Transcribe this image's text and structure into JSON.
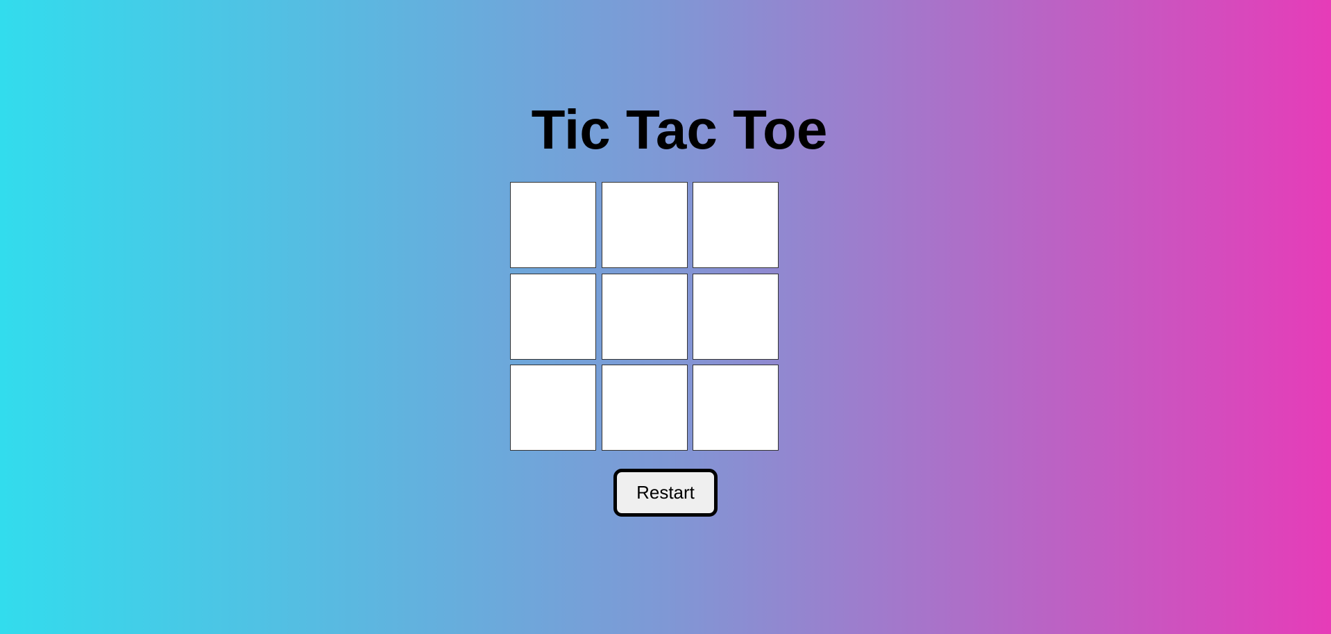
{
  "game": {
    "title": "Tic Tac Toe",
    "board": {
      "cells": [
        "",
        "",
        "",
        "",
        "",
        "",
        "",
        "",
        ""
      ]
    },
    "restart_label": "Restart"
  },
  "colors": {
    "background_gradient": [
      "#32dced",
      "#7f98d5",
      "#e63cb8"
    ],
    "cell_background": "#ffffff",
    "cell_border": "#333333",
    "button_background": "#efefef",
    "button_border": "#000000"
  }
}
